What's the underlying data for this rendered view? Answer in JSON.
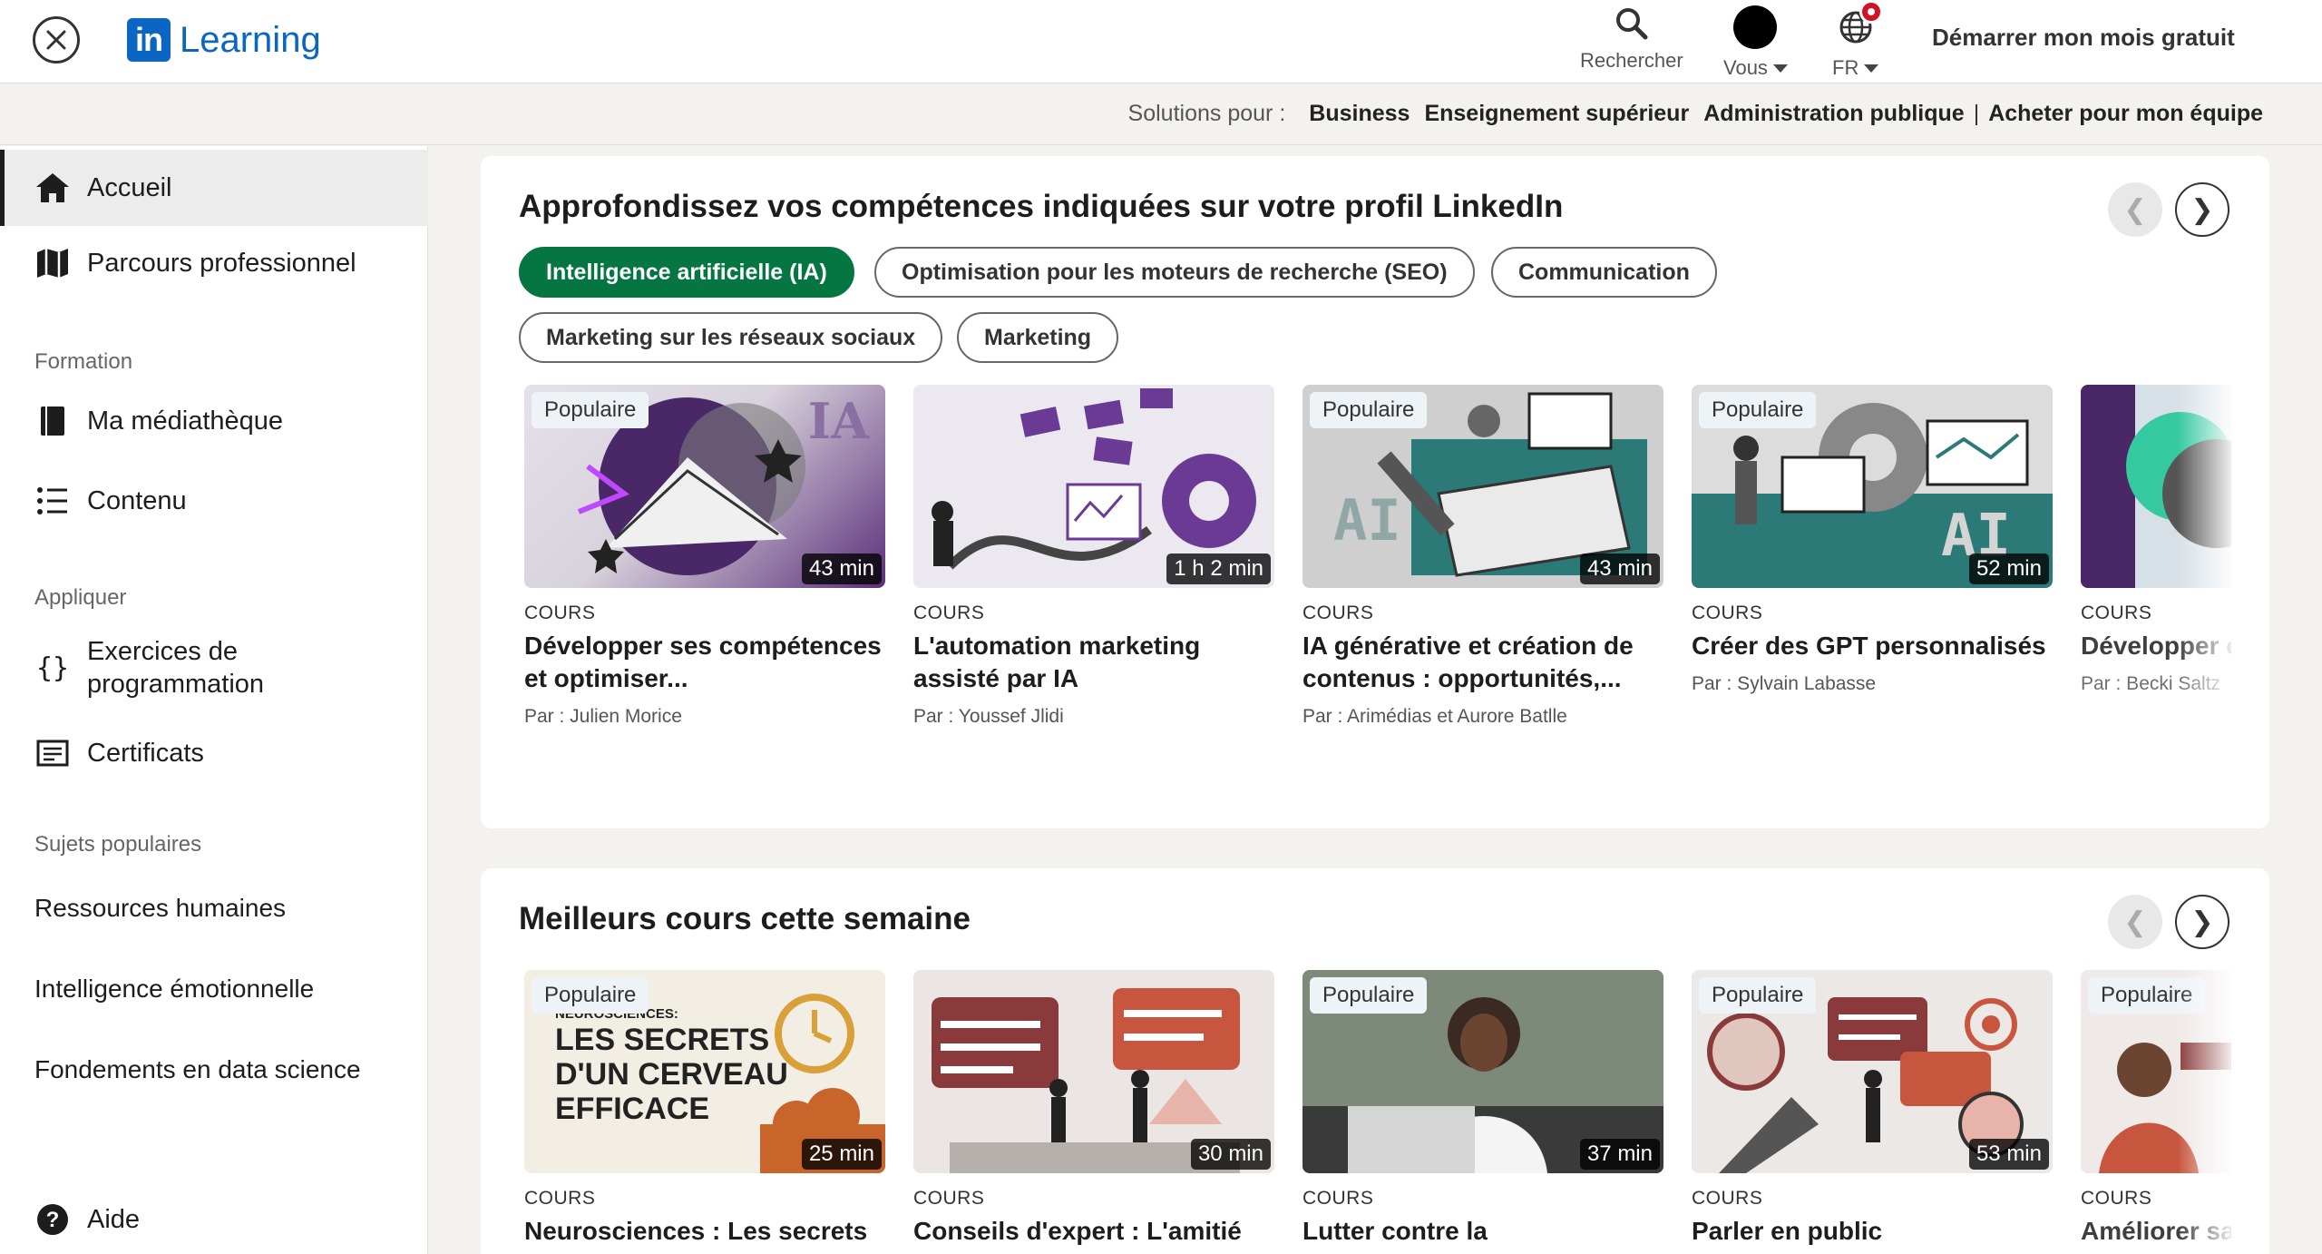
{
  "header": {
    "logo_letters": "in",
    "app_name": "Learning",
    "search_label": "Rechercher",
    "you_label": "Vous",
    "lang_label": "FR",
    "trial_label": "Démarrer mon mois gratuit"
  },
  "solutions": {
    "label": "Solutions pour :",
    "links": [
      "Business",
      "Enseignement supérieur",
      "Administration publique",
      "Acheter pour mon équipe"
    ]
  },
  "sidebar": {
    "home": "Accueil",
    "career": "Parcours professionnel",
    "formation_head": "Formation",
    "library": "Ma médiathèque",
    "content": "Contenu",
    "apply_head": "Appliquer",
    "exercises": "Exercices de programmation",
    "certs": "Certificats",
    "topics_head": "Sujets populaires",
    "topics": [
      "Ressources humaines",
      "Intelligence émotionnelle",
      "Fondements en data science"
    ],
    "help": "Aide"
  },
  "section1": {
    "title": "Approfondissez vos compétences indiquées sur votre profil LinkedIn",
    "pills": [
      "Intelligence artificielle (IA)",
      "Optimisation pour les moteurs de recherche (SEO)",
      "Communication",
      "Marketing sur les réseaux sociaux",
      "Marketing"
    ],
    "courses": [
      {
        "badge": "Populaire",
        "duration": "43 min",
        "type": "COURS",
        "title": "Développer ses compétences et optimiser...",
        "author": "Par : Julien Morice",
        "thumb_text": "IA"
      },
      {
        "badge": "",
        "duration": "1 h 2 min",
        "type": "COURS",
        "title": "L'automation marketing assisté par IA",
        "author": "Par : Youssef Jlidi",
        "thumb_text": ""
      },
      {
        "badge": "Populaire",
        "duration": "43 min",
        "type": "COURS",
        "title": "IA générative et création de contenus : opportunités,...",
        "author": "Par : Arimédias et Aurore Batlle",
        "thumb_text": "AI"
      },
      {
        "badge": "Populaire",
        "duration": "52 min",
        "type": "COURS",
        "title": "Créer des GPT personnalisés",
        "author": "Par : Sylvain Labasse",
        "thumb_text": "AI"
      },
      {
        "badge": "",
        "duration": "",
        "type": "COURS",
        "title": "Développer critique avec",
        "author": "Par : Becki Saltz",
        "thumb_text": ""
      }
    ]
  },
  "section2": {
    "title": "Meilleurs cours cette semaine",
    "courses": [
      {
        "badge": "Populaire",
        "duration": "25 min",
        "type": "COURS",
        "title": "Neurosciences : Les secrets",
        "thumb_text": "NEUROSCIENCES:",
        "thumb_big": "LES SECRETS D'UN CERVEAU EFFICACE"
      },
      {
        "badge": "",
        "duration": "30 min",
        "type": "COURS",
        "title": "Conseils d'expert : L'amitié",
        "thumb_text": ""
      },
      {
        "badge": "Populaire",
        "duration": "37 min",
        "type": "COURS",
        "title": "Lutter contre la",
        "thumb_text": ""
      },
      {
        "badge": "Populaire",
        "duration": "53 min",
        "type": "COURS",
        "title": "Parler en public",
        "thumb_text": ""
      },
      {
        "badge": "Populaire",
        "duration": "",
        "type": "COURS",
        "title": "Améliorer sa",
        "thumb_text": ""
      }
    ]
  },
  "colors": {
    "brand": "#0a66c2",
    "pill_selected": "#057642",
    "notification": "#d11124"
  }
}
